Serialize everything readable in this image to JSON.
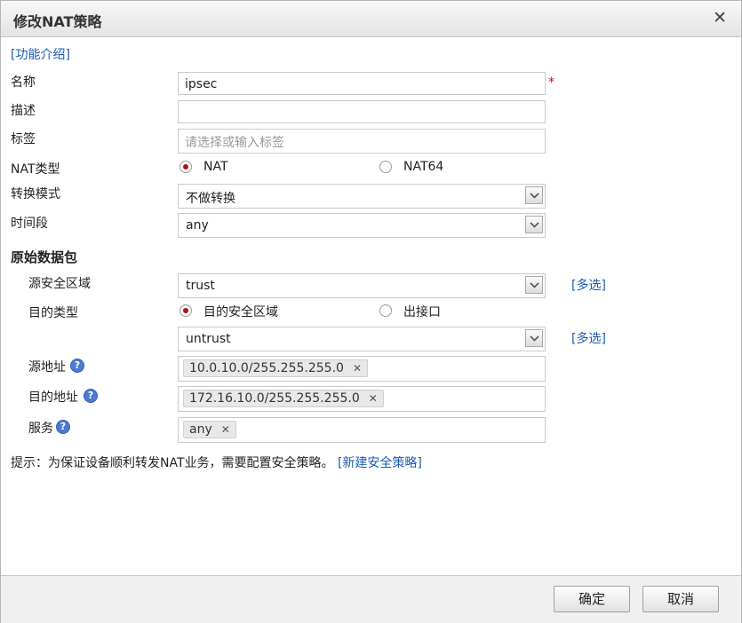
{
  "dialog": {
    "title": "修改NAT策略",
    "close_symbol": "✕"
  },
  "intro_link": "[功能介绍]",
  "fields": {
    "name": {
      "label": "名称",
      "value": "ipsec",
      "required_mark": "*"
    },
    "description": {
      "label": "描述",
      "value": ""
    },
    "tags": {
      "label": "标签",
      "placeholder": "请选择或输入标签"
    },
    "nat_type": {
      "label": "NAT类型",
      "options": [
        "NAT",
        "NAT64"
      ],
      "selected": "NAT"
    },
    "convert_mode": {
      "label": "转换模式",
      "value": "不做转换"
    },
    "time_range": {
      "label": "时间段",
      "value": "any"
    }
  },
  "original_packet": {
    "heading": "原始数据包",
    "source_zone": {
      "label": "源安全区域",
      "value": "trust",
      "multi_select": "[多选]"
    },
    "dest_type": {
      "label": "目的类型",
      "options": [
        "目的安全区域",
        "出接口"
      ],
      "selected": "目的安全区域"
    },
    "dest_zone": {
      "value": "untrust",
      "multi_select": "[多选]"
    },
    "source_address": {
      "label": "源地址",
      "tags": [
        "10.0.10.0/255.255.255.0"
      ]
    },
    "dest_address": {
      "label": "目的地址",
      "tags": [
        "172.16.10.0/255.255.255.0"
      ]
    },
    "service": {
      "label": "服务",
      "tags": [
        "any"
      ]
    }
  },
  "hint": {
    "text": "提示：为保证设备顺利转发NAT业务，需要配置安全策略。",
    "link": "[新建安全策略]"
  },
  "buttons": {
    "ok": "确定",
    "cancel": "取消"
  },
  "icons": {
    "help": "?",
    "tag_remove": "✕"
  },
  "colors": {
    "link": "#1a5cb0",
    "required": "#dd0000",
    "radio_selected": "#b01010",
    "help_icon": "#4a7bd0"
  }
}
